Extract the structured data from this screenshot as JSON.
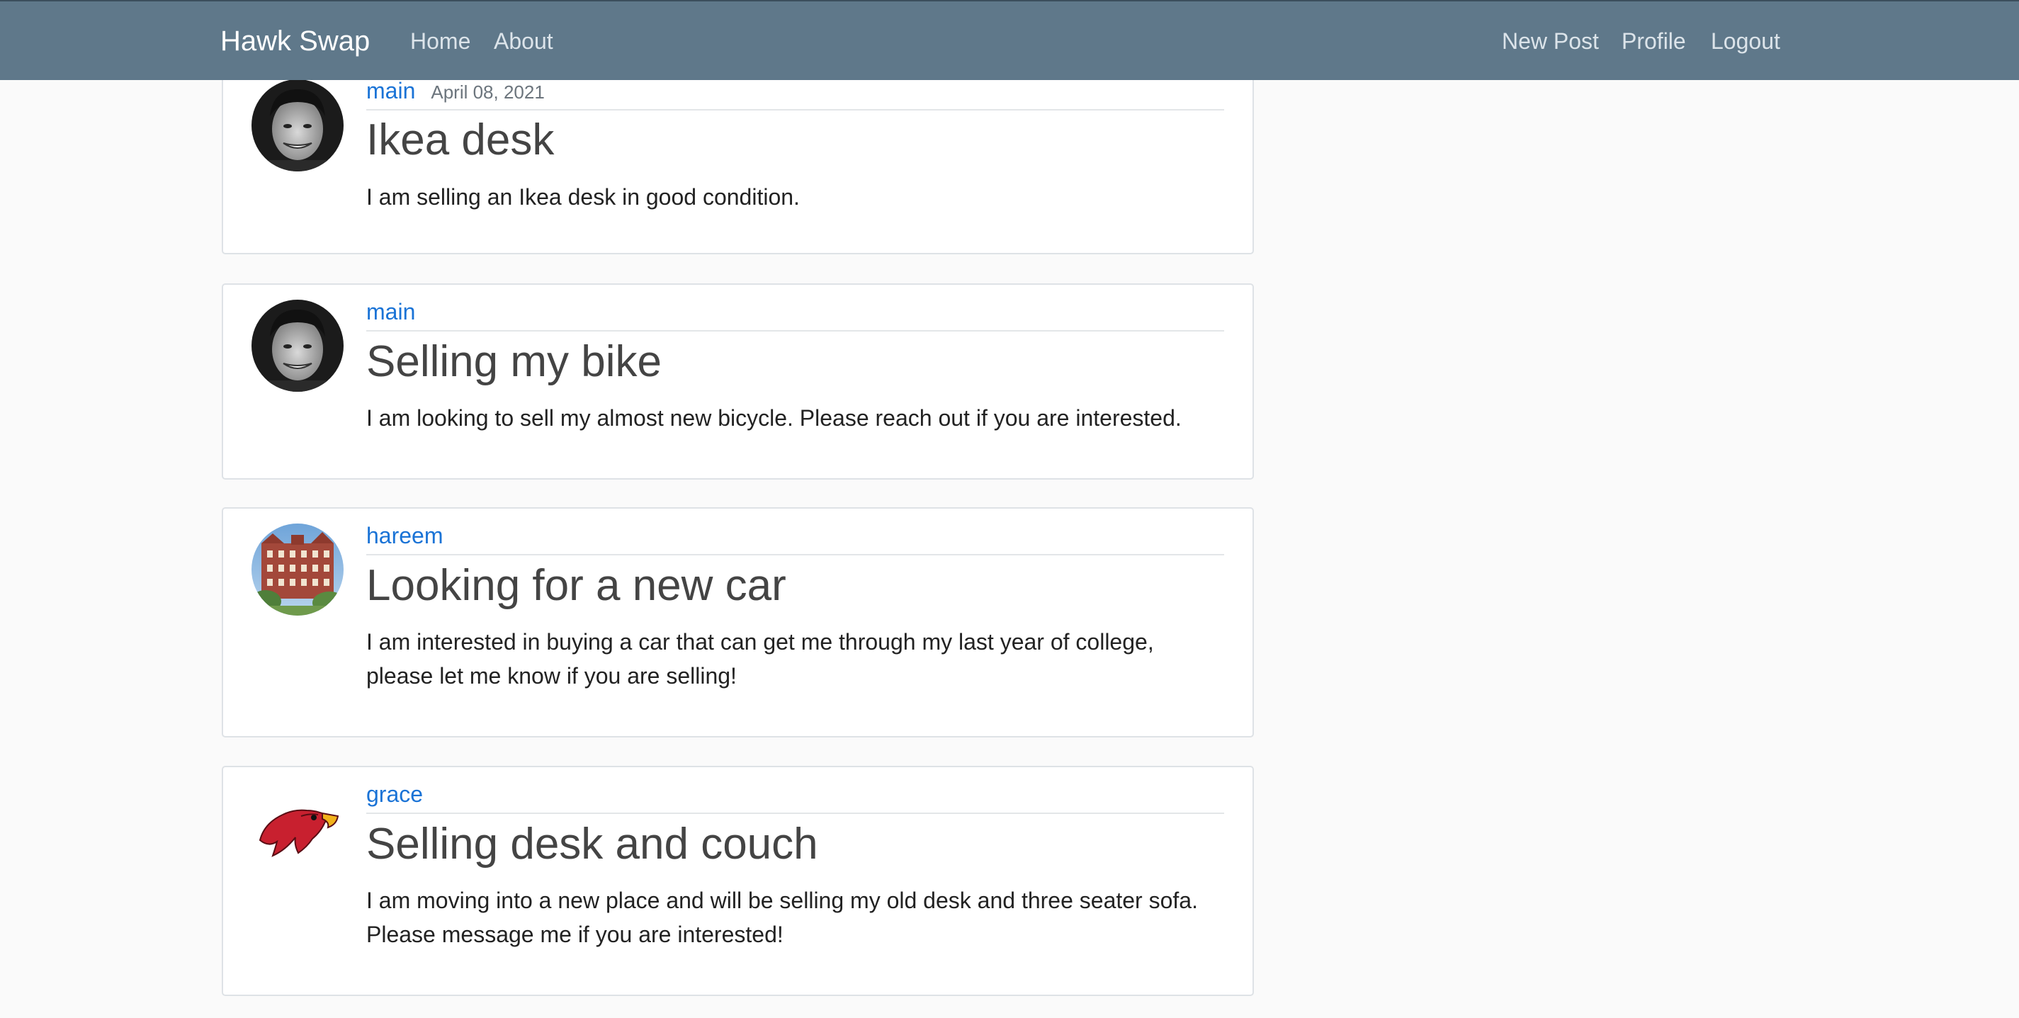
{
  "navbar": {
    "brand": "Hawk Swap",
    "links_left": [
      "Home",
      "About"
    ],
    "links_right": [
      "New Post",
      "Profile",
      "Logout"
    ]
  },
  "posts": [
    {
      "author": "main",
      "date": "April 08, 2021",
      "title": "Ikea desk",
      "body": "I am selling an Ikea desk in good condition.",
      "avatar": "profile-photo-icon"
    },
    {
      "author": "main",
      "date": "",
      "title": "Selling my bike",
      "body": "I am looking to sell my almost new bicycle. Please reach out if you are interested.",
      "avatar": "profile-photo-icon"
    },
    {
      "author": "hareem",
      "date": "",
      "title": "Looking for a new car",
      "body": "I am interested in buying a car that can get me through my last year of college, please let me know if you are selling!",
      "avatar": "building-photo-icon"
    },
    {
      "author": "grace",
      "date": "",
      "title": "Selling desk and couch",
      "body": "I am moving into a new place and will be selling my old desk and three seater sofa. Please message me if you are interested!",
      "avatar": "hawk-logo-icon"
    }
  ],
  "colors": {
    "navbar_bg": "#5f788a",
    "author_link": "#1a73d6",
    "page_bg": "#fafafa"
  }
}
